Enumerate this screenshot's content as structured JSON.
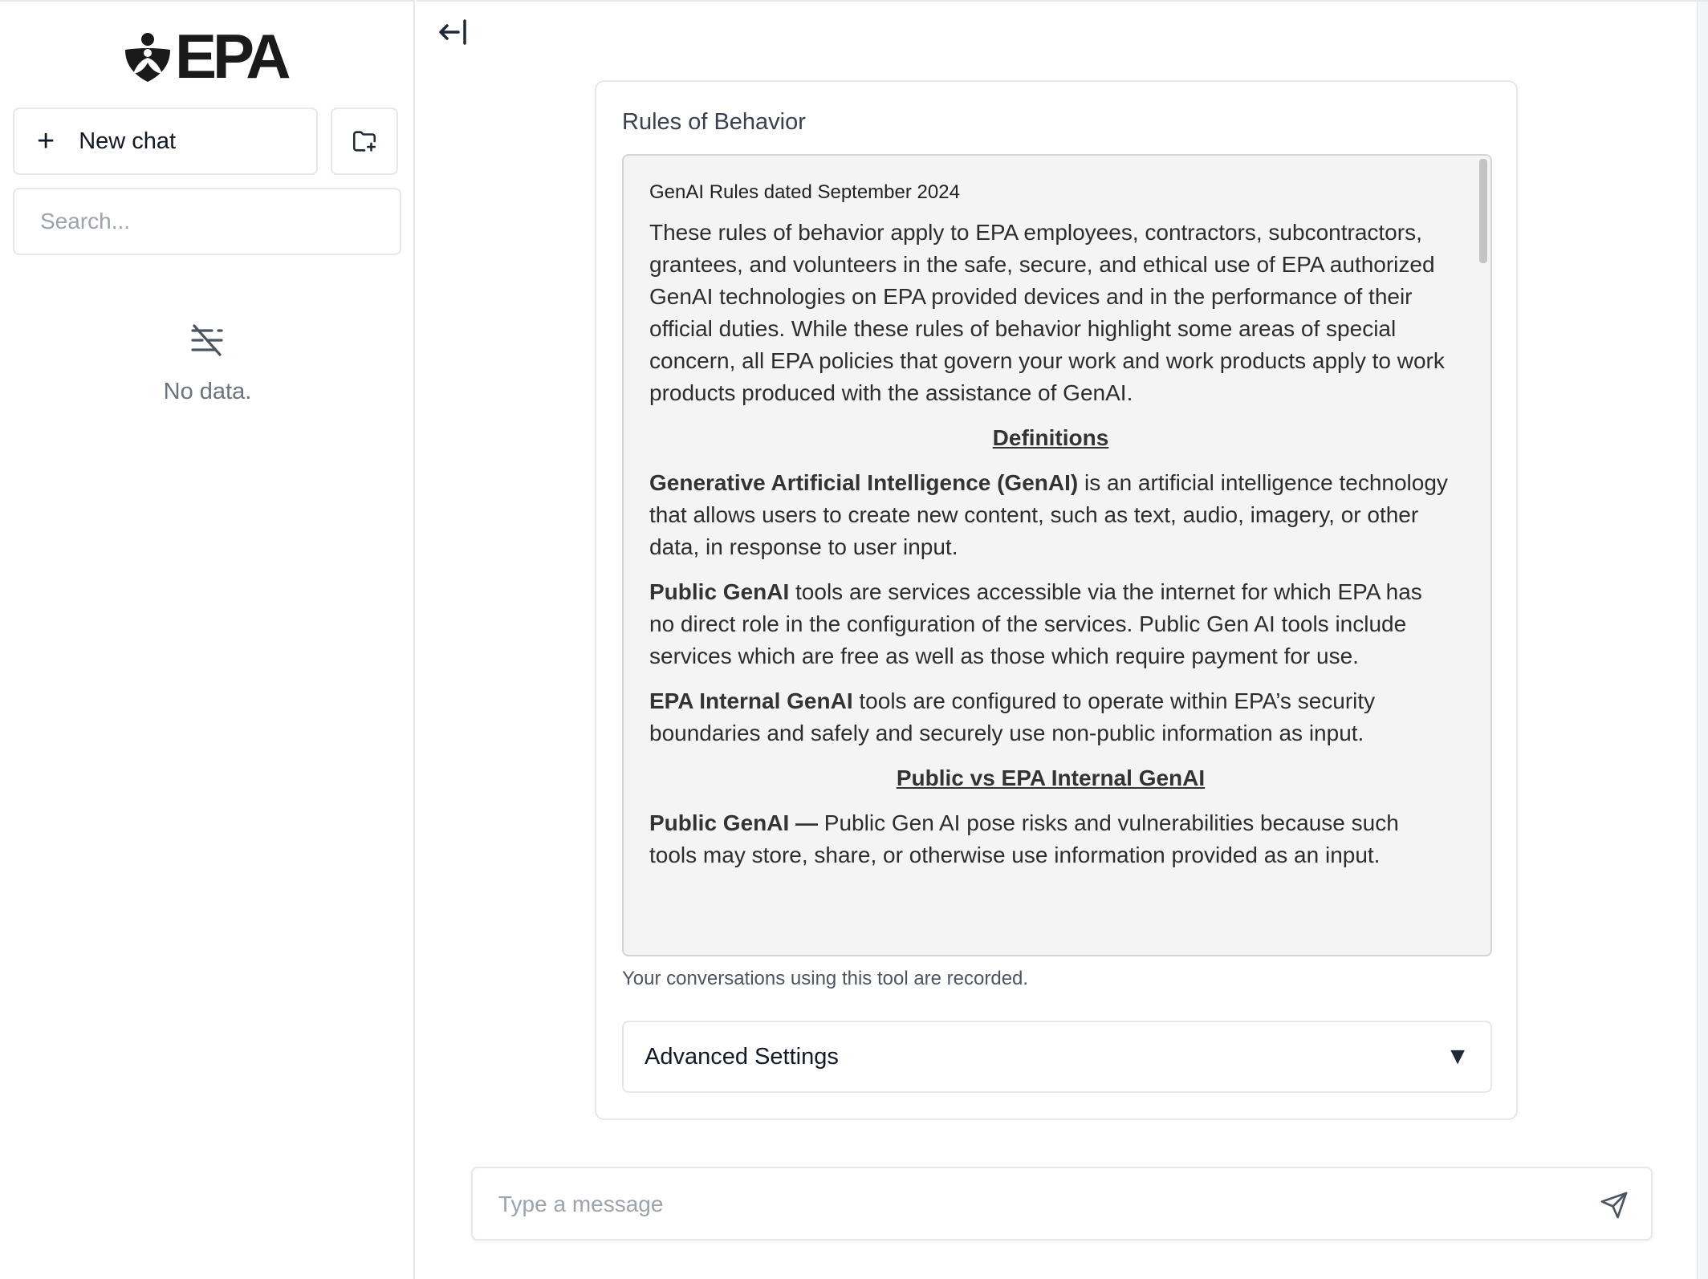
{
  "sidebar": {
    "logo_text": "EPA",
    "new_chat_label": "New chat",
    "search_placeholder": "Search...",
    "empty_text": "No data."
  },
  "card": {
    "title": "Rules of Behavior",
    "rules_date": "GenAI Rules dated September 2024",
    "intro": "These rules of behavior apply to EPA employees, contractors, subcontractors, grantees, and volunteers in the safe, secure, and ethical use of EPA authorized GenAI technologies on EPA provided devices and in the performance of their official duties. While these rules of behavior highlight some areas of special concern, all EPA policies that govern your work and work products apply to work products produced with the assistance of GenAI.",
    "definitions_heading": "Definitions",
    "def_genai_term": "Generative Artificial Intelligence (GenAI)",
    "def_genai_text": " is an artificial intelligence technology that allows users to create new content, such as text, audio, imagery, or other data, in response to user input.",
    "def_public_term": "Public GenAI",
    "def_public_text": " tools are services accessible via the internet for which EPA has no direct role in the configuration of the services. Public Gen AI tools include services which are free as well as those which require payment for use.",
    "def_internal_term": "EPA Internal GenAI",
    "def_internal_text": " tools are configured to operate within EPA’s security boundaries and safely and securely use non-public information as input.",
    "compare_heading": "Public vs EPA Internal GenAI",
    "public_risk_term": "Public GenAI —",
    "public_risk_text": " Public Gen AI pose risks and vulnerabilities because such tools may store, share, or otherwise use information provided as an input.",
    "recorded_notice": "Your conversations using this tool are recorded.",
    "advanced_label": "Advanced Settings",
    "advanced_arrow": "▼"
  },
  "composer": {
    "placeholder": "Type a message"
  },
  "icons": {
    "collapse": "collapse-sidebar-icon",
    "new_folder": "new-folder-icon",
    "no_data": "no-data-icon",
    "send": "send-icon"
  }
}
